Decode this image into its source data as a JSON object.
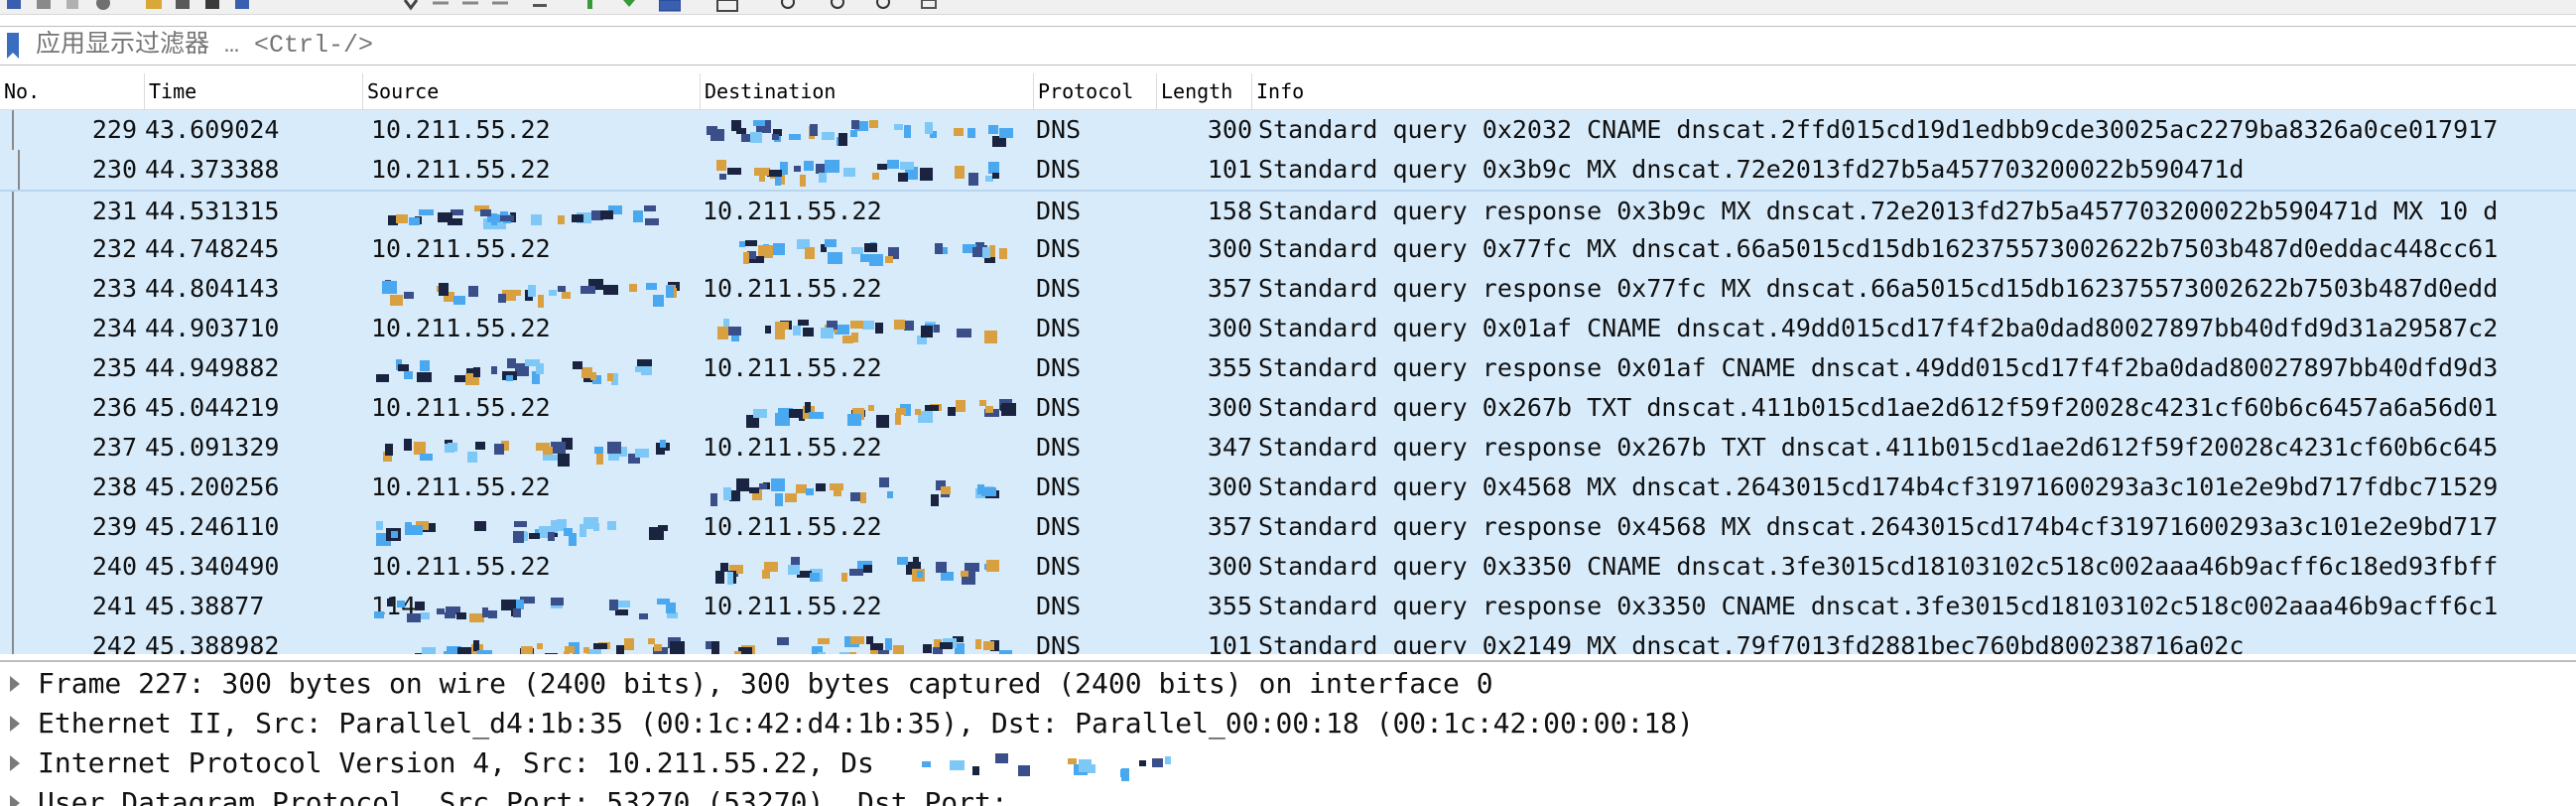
{
  "filter": {
    "placeholder": "应用显示过滤器 … <Ctrl-/>"
  },
  "columns": [
    "No.",
    "Time",
    "Source",
    "Destination",
    "Protocol",
    "Length",
    "Info"
  ],
  "packets": [
    {
      "no": "229",
      "time": "43.609024",
      "src": "10.211.55.22",
      "dst": "",
      "proto": "DNS",
      "len": "300",
      "info": "Standard query 0x2032 CNAME dnscat.2ffd015cd19d1edbb9cde30025ac2279ba8326a0ce017917"
    },
    {
      "no": "230",
      "time": "44.373388",
      "src": "10.211.55.22",
      "dst": "",
      "proto": "DNS",
      "len": "101",
      "info": "Standard query 0x3b9c MX dnscat.72e2013fd27b5a457703200022b590471d"
    },
    {
      "no": "231",
      "time": "44.531315",
      "src": "",
      "dst": "10.211.55.22",
      "proto": "DNS",
      "len": "158",
      "info": "Standard query response 0x3b9c MX dnscat.72e2013fd27b5a457703200022b590471d MX 10 d"
    },
    {
      "no": "232",
      "time": "44.748245",
      "src": "10.211.55.22",
      "dst": "",
      "proto": "DNS",
      "len": "300",
      "info": "Standard query 0x77fc MX dnscat.66a5015cd15db162375573002622b7503b487d0eddac448cc61"
    },
    {
      "no": "233",
      "time": "44.804143",
      "src": "",
      "dst": "10.211.55.22",
      "proto": "DNS",
      "len": "357",
      "info": "Standard query response 0x77fc MX dnscat.66a5015cd15db162375573002622b7503b487d0edd"
    },
    {
      "no": "234",
      "time": "44.903710",
      "src": "10.211.55.22",
      "dst": "",
      "proto": "DNS",
      "len": "300",
      "info": "Standard query 0x01af CNAME dnscat.49dd015cd17f4f2ba0dad80027897bb40dfd9d31a29587c2"
    },
    {
      "no": "235",
      "time": "44.949882",
      "src": "",
      "dst": "10.211.55.22",
      "proto": "DNS",
      "len": "355",
      "info": "Standard query response 0x01af CNAME dnscat.49dd015cd17f4f2ba0dad80027897bb40dfd9d3"
    },
    {
      "no": "236",
      "time": "45.044219",
      "src": "10.211.55.22",
      "dst": "",
      "proto": "DNS",
      "len": "300",
      "info": "Standard query 0x267b TXT dnscat.411b015cd1ae2d612f59f20028c4231cf60b6c6457a6a56d01"
    },
    {
      "no": "237",
      "time": "45.091329",
      "src": "",
      "dst": "10.211.55.22",
      "proto": "DNS",
      "len": "347",
      "info": "Standard query response 0x267b TXT dnscat.411b015cd1ae2d612f59f20028c4231cf60b6c645"
    },
    {
      "no": "238",
      "time": "45.200256",
      "src": "10.211.55.22",
      "dst": "",
      "proto": "DNS",
      "len": "300",
      "info": "Standard query 0x4568 MX dnscat.2643015cd174b4cf31971600293a3c101e2e9bd717fdbc71529"
    },
    {
      "no": "239",
      "time": "45.246110",
      "src": "",
      "dst": "10.211.55.22",
      "proto": "DNS",
      "len": "357",
      "info": "Standard query response 0x4568 MX dnscat.2643015cd174b4cf31971600293a3c101e2e9bd717"
    },
    {
      "no": "240",
      "time": "45.340490",
      "src": "10.211.55.22",
      "dst": "",
      "proto": "DNS",
      "len": "300",
      "info": "Standard query 0x3350 CNAME dnscat.3fe3015cd18103102c518c002aaa46b9acff6c18ed93fbff"
    },
    {
      "no": "241",
      "time": "45.38877",
      "src": "114",
      "dst": "10.211.55.22",
      "proto": "DNS",
      "len": "355",
      "info": "Standard query response 0x3350 CNAME dnscat.3fe3015cd18103102c518c002aaa46b9acff6c1"
    },
    {
      "no": "242",
      "time": "45.388982",
      "src": "",
      "dst": "",
      "proto": "DNS",
      "len": "101",
      "info": "Standard query 0x2149 MX dnscat.79f7013fd2881bec760bd800238716a02c"
    }
  ],
  "details": [
    "Frame 227: 300 bytes on wire (2400 bits), 300 bytes captured (2400 bits) on interface 0",
    "Ethernet II, Src: Parallel_d4:1b:35 (00:1c:42:d4:1b:35), Dst: Parallel_00:00:18 (00:1c:42:00:00:18)",
    "Internet Protocol Version 4, Src: 10.211.55.22, Ds",
    "User Datagram Protocol, Src Port: 53270 (53270), Dst Port:"
  ],
  "colors": {
    "row_bg": "#d7ebfb",
    "mosaic_dark": "#3a4f8a",
    "mosaic_gold": "#d8a040",
    "mosaic_blue": "#4aa8f0"
  }
}
